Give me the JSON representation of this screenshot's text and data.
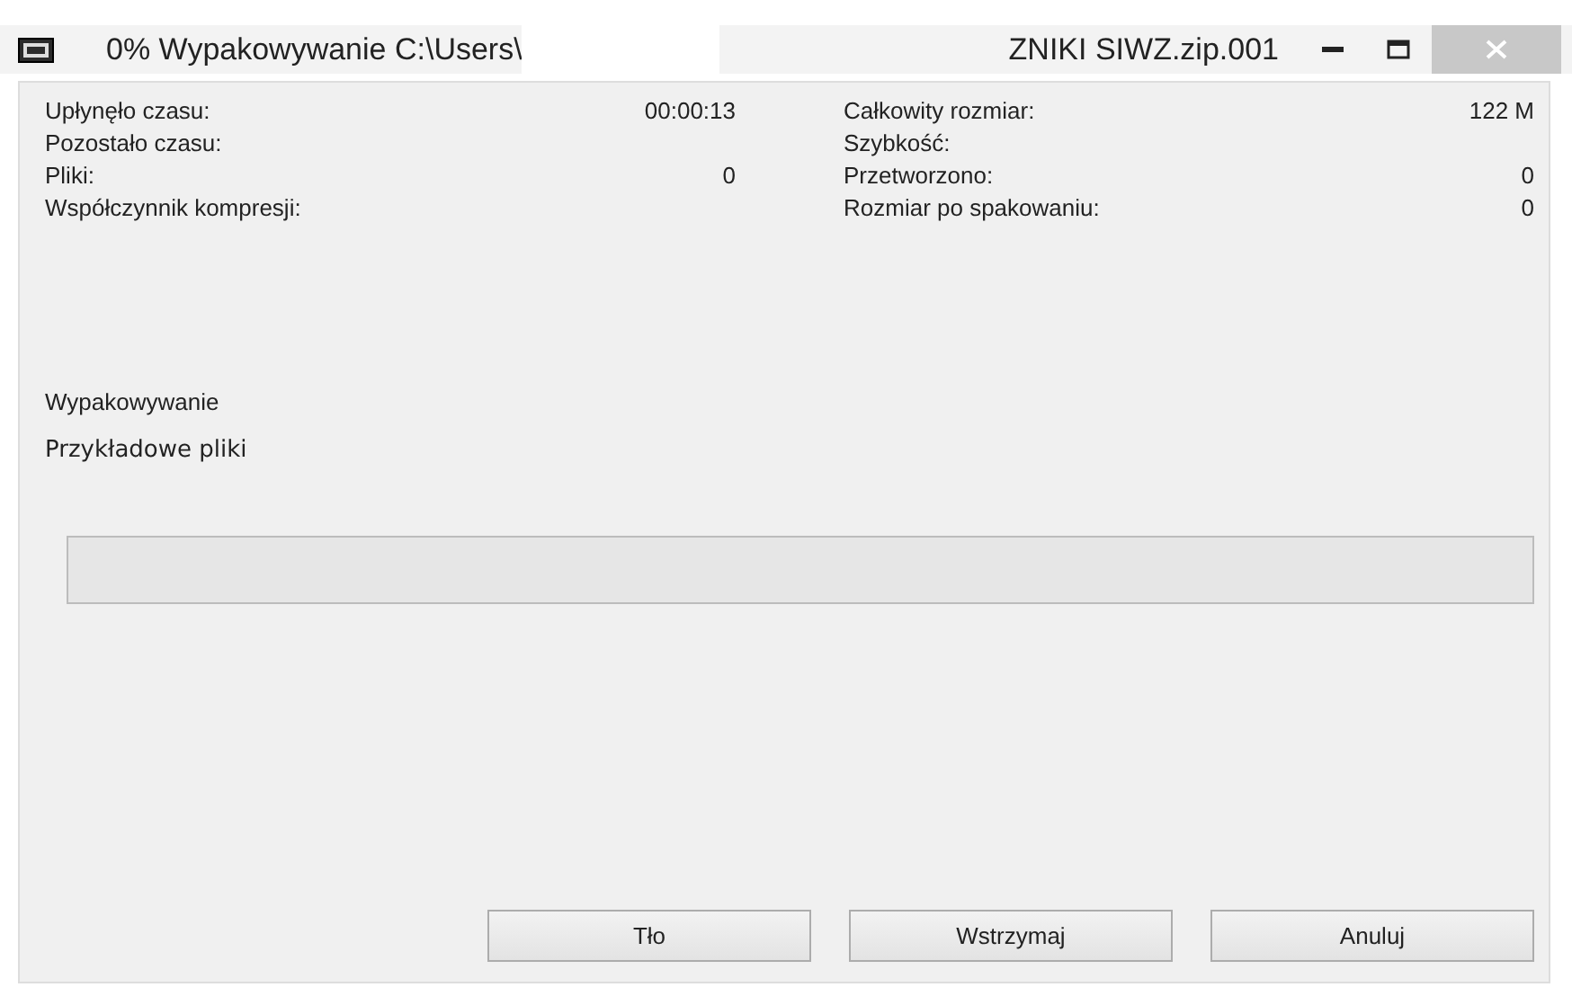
{
  "window": {
    "title_parts": [
      "0% Wypakowywanie C:\\Users\\",
      "ZNIKI SIWZ.zip.001"
    ]
  },
  "stats_left": [
    {
      "label": "Upłynęło czasu:",
      "value": "00:00:13"
    },
    {
      "label": "Pozostało czasu:"
    },
    {
      "label": "Pliki:",
      "value": "0"
    },
    {
      "label": "Współczynnik kompresji:"
    }
  ],
  "stats_right": [
    {
      "label": "Całkowity rozmiar:",
      "value": "122 M"
    },
    {
      "label": "Szybkość:"
    },
    {
      "label": "Przetworzono:",
      "value": "0"
    },
    {
      "label": "Rozmiar po spakowaniu:",
      "value": "0"
    }
  ],
  "operation": "Wypakowywanie",
  "current_file": "Przykładowe pliki",
  "progress": {
    "level": 0
  },
  "buttons": [
    "Tło",
    "Wstrzymaj",
    "Anuluj"
  ]
}
